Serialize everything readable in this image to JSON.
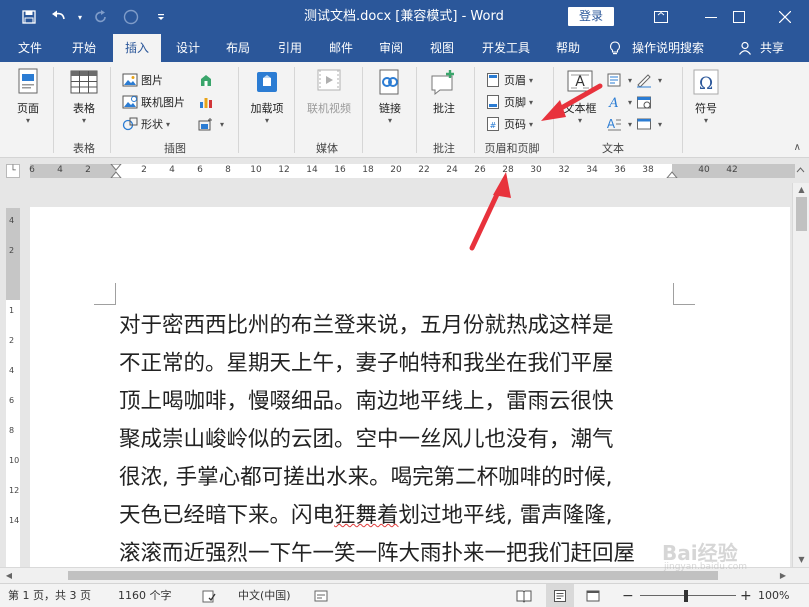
{
  "window": {
    "title": "测试文档.docx [兼容模式] - Word",
    "login_label": "登录",
    "share_label": "共享",
    "help_search": "操作说明搜索"
  },
  "colors": {
    "brand": "#2b579a",
    "annotation": "#e8323c"
  },
  "tabs": [
    {
      "label": "文件"
    },
    {
      "label": "开始"
    },
    {
      "label": "插入",
      "active": true
    },
    {
      "label": "设计"
    },
    {
      "label": "布局"
    },
    {
      "label": "引用"
    },
    {
      "label": "邮件"
    },
    {
      "label": "审阅"
    },
    {
      "label": "视图"
    },
    {
      "label": "开发工具"
    },
    {
      "label": "帮助"
    }
  ],
  "ribbon": {
    "pages": {
      "button": "页面",
      "group": ""
    },
    "tables": {
      "button": "表格",
      "group": "表格"
    },
    "illustrations": {
      "picture": "图片",
      "online_picture": "联机图片",
      "shapes": "形状",
      "group": "插图"
    },
    "addins": {
      "button": "加载项"
    },
    "media": {
      "button": "联机视频",
      "group": "媒体"
    },
    "links": {
      "button": "链接"
    },
    "comments": {
      "button": "批注",
      "group": "批注"
    },
    "header_footer": {
      "header": "页眉",
      "footer": "页脚",
      "page_number": "页码",
      "group": "页眉和页脚"
    },
    "text": {
      "textbox": "文本框",
      "group": "文本"
    },
    "symbols": {
      "button": "符号"
    }
  },
  "ruler": {
    "numbers": [
      "6",
      "4",
      "2",
      "",
      "2",
      "4",
      "6",
      "8",
      "10",
      "12",
      "14",
      "16",
      "18",
      "20",
      "22",
      "24",
      "26",
      "28",
      "30",
      "32",
      "34",
      "36",
      "38",
      "",
      "40",
      "42"
    ]
  },
  "vruler": {
    "numbers": [
      "4",
      "2",
      "",
      "1",
      "2",
      "4",
      "6",
      "8",
      "10",
      "12",
      "14"
    ]
  },
  "document": {
    "lines": [
      "对于密西西比州的布兰登来说，五月份就热成这样是",
      "不正常的。星期天上午，妻子帕特和我坐在我们平屋",
      "顶上喝咖啡，慢啜细品。南边地平线上，雷雨云很快",
      "聚成崇山峻岭似的云团。空中一丝风儿也没有，潮气",
      "很浓, 手掌心都可搓出水来。喝完第二杯咖啡的时候,",
      "天色已经暗下来。闪电狂舞着划过地平线, 雷声隆隆,"
    ],
    "line6_pre": "天色已经暗下来。闪电",
    "line6_squiggle": "狂舞着",
    "line6_post": "划过地平线, 雷声隆隆,",
    "line7_partial": "滚滚而近强烈一下午一笑一阵大雨扑来一把我们赶回屋"
  },
  "status": {
    "page": "第 1 页，共 3 页",
    "words": "1160 个字",
    "language": "中文(中国)",
    "zoom": "100%"
  },
  "watermark": {
    "text": "Bai经验",
    "sub": "jingyan.baidu.com"
  }
}
